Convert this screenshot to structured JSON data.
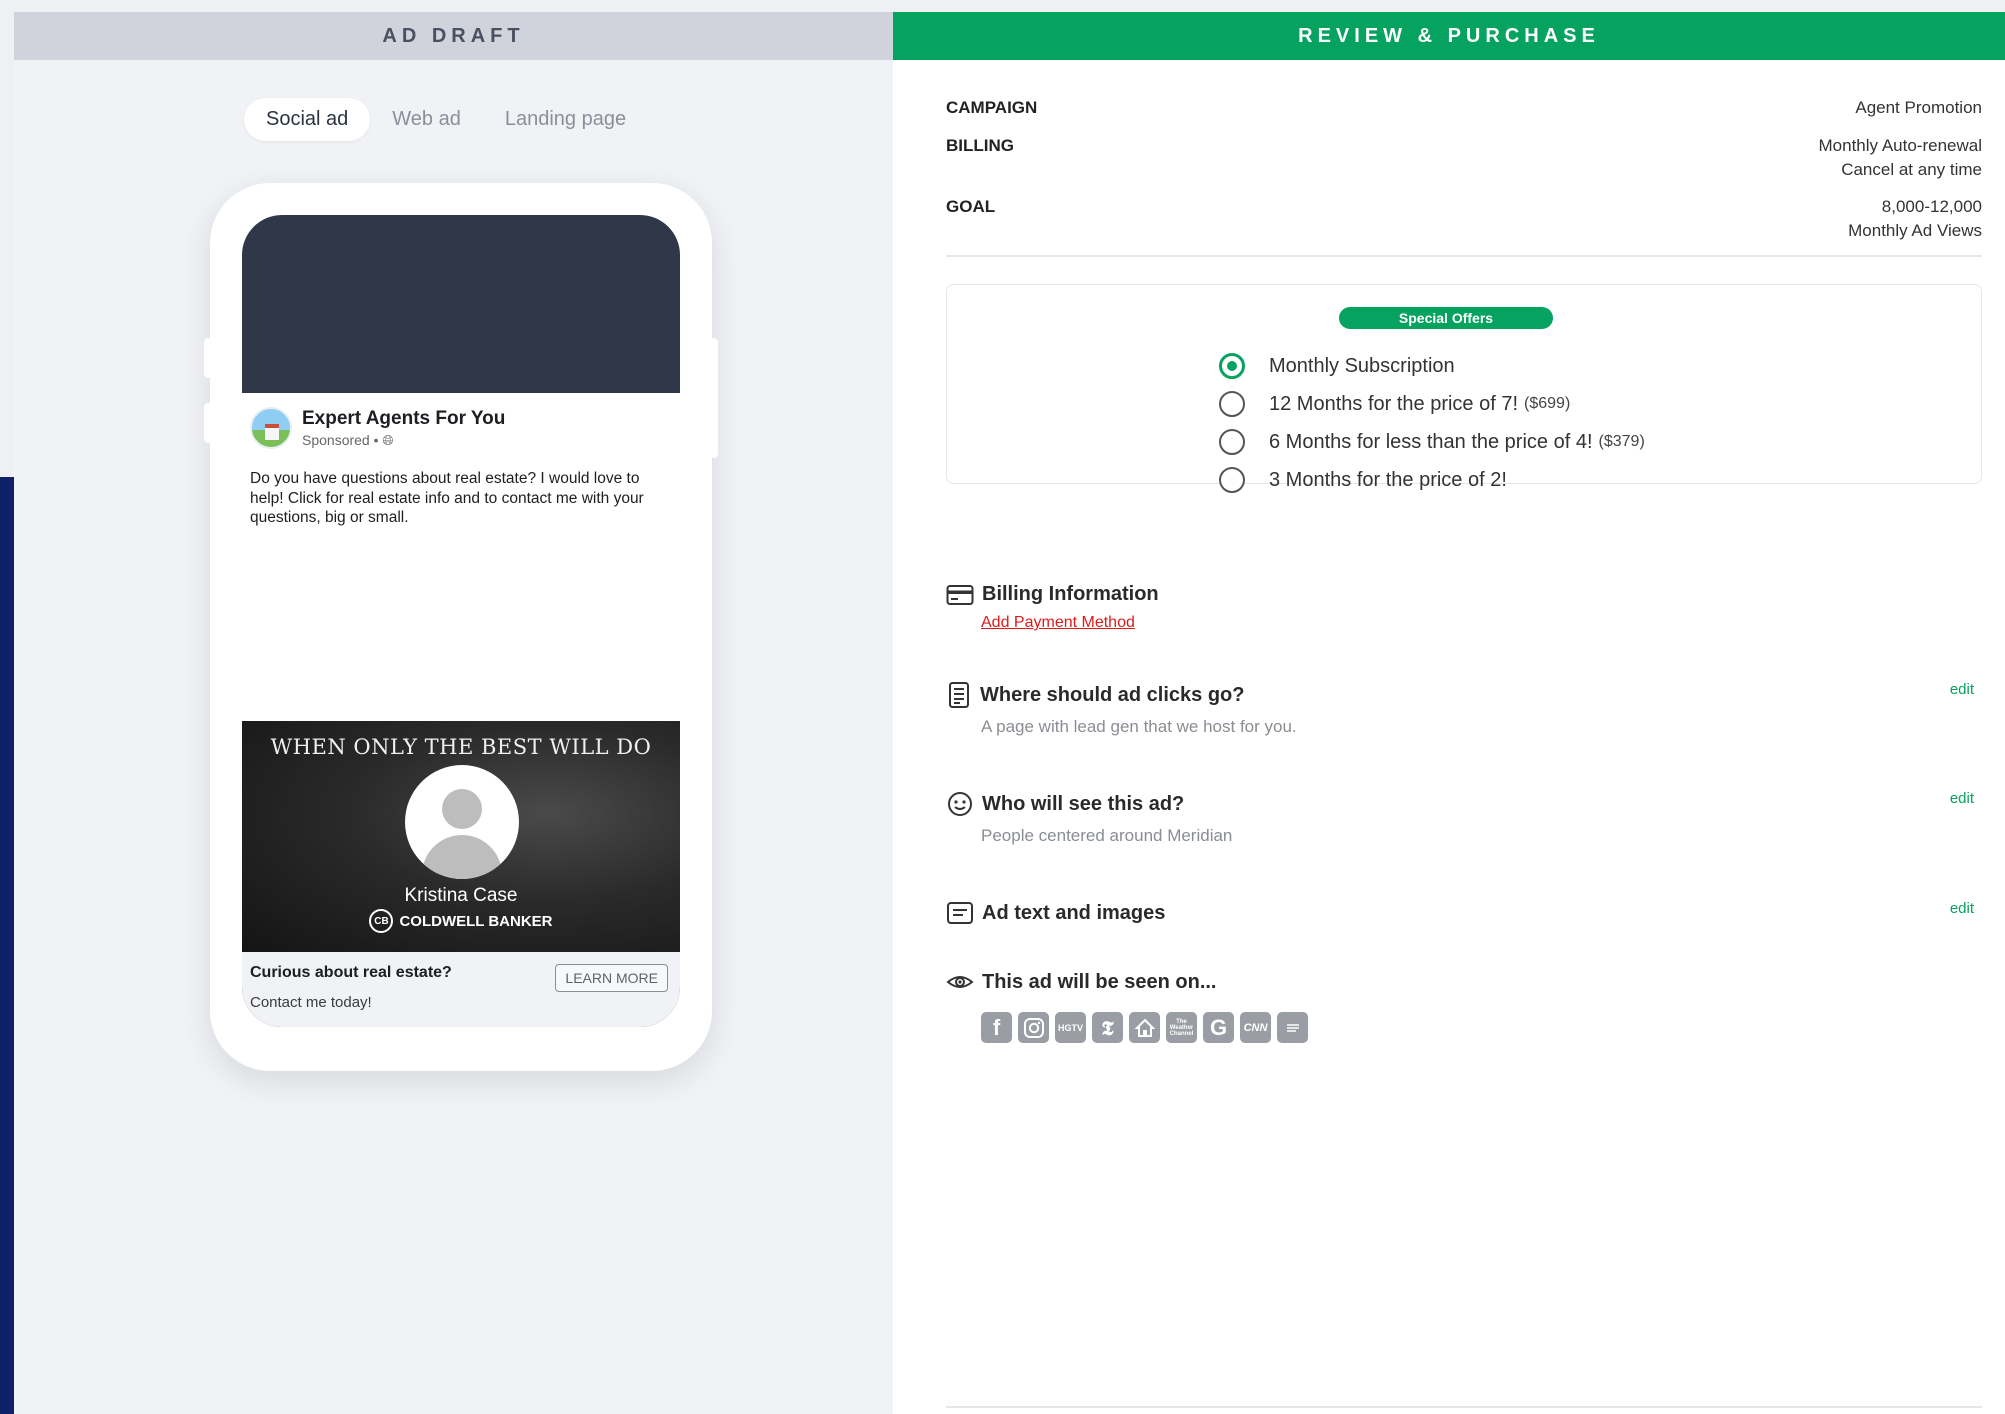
{
  "left_panel": {
    "header": "AD DRAFT",
    "tabs": [
      {
        "label": "Social ad",
        "active": true
      },
      {
        "label": "Web ad",
        "active": false
      },
      {
        "label": "Landing page",
        "active": false
      }
    ]
  },
  "ad_preview": {
    "page_name": "Expert Agents For You",
    "sponsored": "Sponsored • ",
    "body": "Do you have questions about real estate? I would love to help! Click for real estate info and to contact me with your questions, big or small.",
    "image_tagline": "WHEN ONLY THE BEST WILL DO",
    "agent_name": "Kristina Case",
    "brand": "COLDWELL BANKER",
    "headline": "Curious about real estate?",
    "subheadline": "Contact me today!",
    "cta": "LEARN MORE"
  },
  "right_panel": {
    "header": "REVIEW & PURCHASE",
    "summary": {
      "campaign_label": "CAMPAIGN",
      "campaign_value": "Agent Promotion",
      "billing_label": "BILLING",
      "billing_value_1": "Monthly Auto-renewal",
      "billing_value_2": "Cancel at any time",
      "goal_label": "GOAL",
      "goal_value_1": "8,000-12,000",
      "goal_value_2": "Monthly Ad Views"
    },
    "offers": {
      "badge": "Special Offers",
      "options": [
        {
          "label": "Monthly Subscription",
          "price": "",
          "selected": true
        },
        {
          "label": "12 Months for the price of 7!",
          "price": "($699)",
          "selected": false
        },
        {
          "label": "6 Months for less than the price of 4!",
          "price": "($379)",
          "selected": false
        },
        {
          "label": "3 Months for the price of 2!",
          "price": "",
          "selected": false
        }
      ]
    },
    "billing_info": {
      "title": "Billing Information",
      "link": "Add Payment Method"
    },
    "ad_clicks": {
      "title": "Where should ad clicks go?",
      "subtitle": "A page with lead gen that we host for you.",
      "edit": "edit"
    },
    "audience": {
      "title": "Who will see this ad?",
      "subtitle": "People centered around Meridian",
      "edit": "edit"
    },
    "ad_text": {
      "title": "Ad text and images",
      "edit": "edit"
    },
    "seen_on": {
      "title": "This ad will be seen on...",
      "networks": [
        {
          "name": "facebook-icon",
          "glyph": "f"
        },
        {
          "name": "instagram-icon",
          "glyph": ""
        },
        {
          "name": "hgtv-icon",
          "glyph": "HGTV"
        },
        {
          "name": "nytimes-icon",
          "glyph": "𝕿"
        },
        {
          "name": "realtor-icon",
          "glyph": ""
        },
        {
          "name": "weather-channel-icon",
          "glyph": "The Weather Channel"
        },
        {
          "name": "google-icon",
          "glyph": "G"
        },
        {
          "name": "cnn-icon",
          "glyph": "CNN"
        },
        {
          "name": "news-network-icon",
          "glyph": ""
        }
      ]
    }
  },
  "colors": {
    "accent_green": "#05a35f",
    "link_red": "#e11b1b",
    "phone_screen": "#2f3749",
    "navy_backdrop": "#0d2068"
  }
}
